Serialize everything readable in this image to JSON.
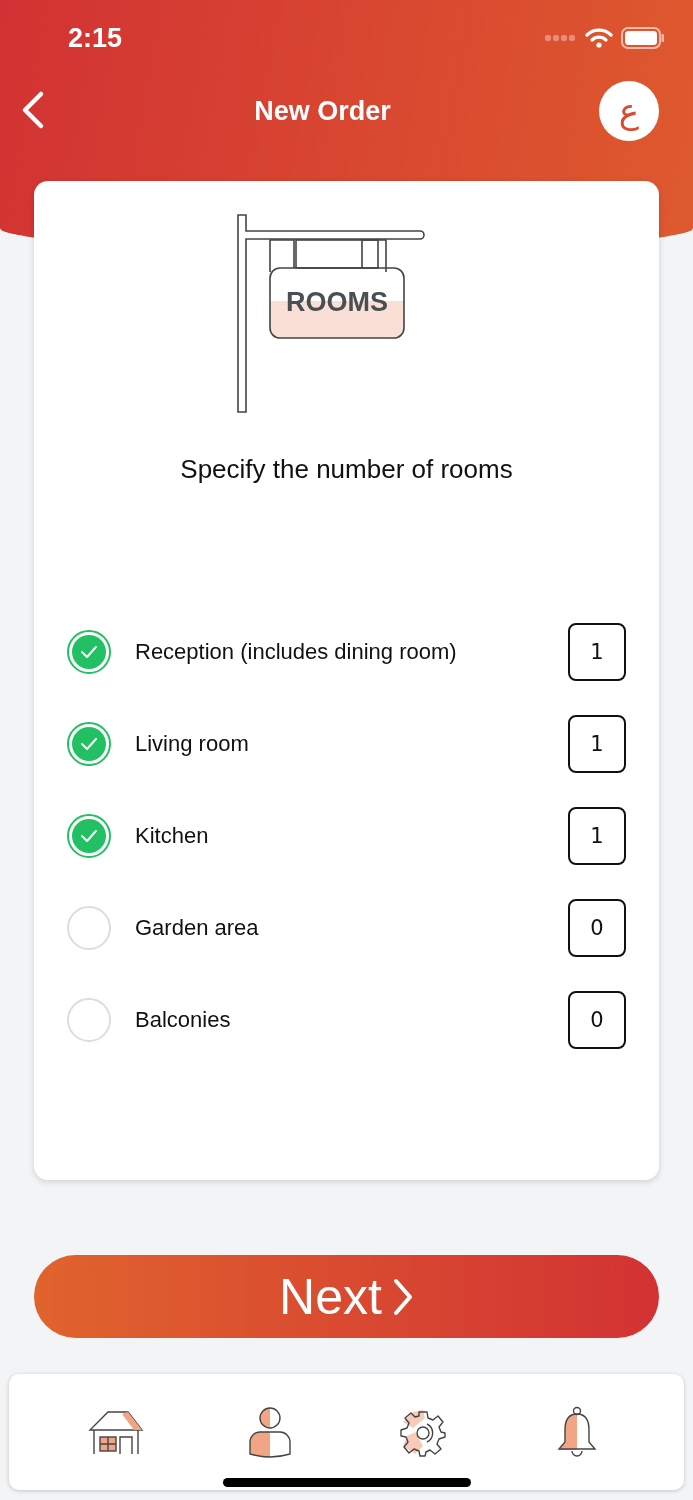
{
  "status_bar": {
    "time": "2:15"
  },
  "nav": {
    "title": "New Order",
    "language_button": "ع"
  },
  "sign": {
    "text": "ROOMS"
  },
  "heading": "Specify the number of rooms",
  "rooms": [
    {
      "label": "Reception (includes dining room)",
      "checked": true,
      "count": "1"
    },
    {
      "label": "Living room",
      "checked": true,
      "count": "1"
    },
    {
      "label": "Kitchen",
      "checked": true,
      "count": "1"
    },
    {
      "label": "Garden area",
      "checked": false,
      "count": "0"
    },
    {
      "label": "Balconies",
      "checked": false,
      "count": "0"
    }
  ],
  "next_button": {
    "label": "Next"
  },
  "tab_bar": [
    {
      "kind": "home"
    },
    {
      "kind": "profile"
    },
    {
      "kind": "settings"
    },
    {
      "kind": "notifications"
    }
  ]
}
